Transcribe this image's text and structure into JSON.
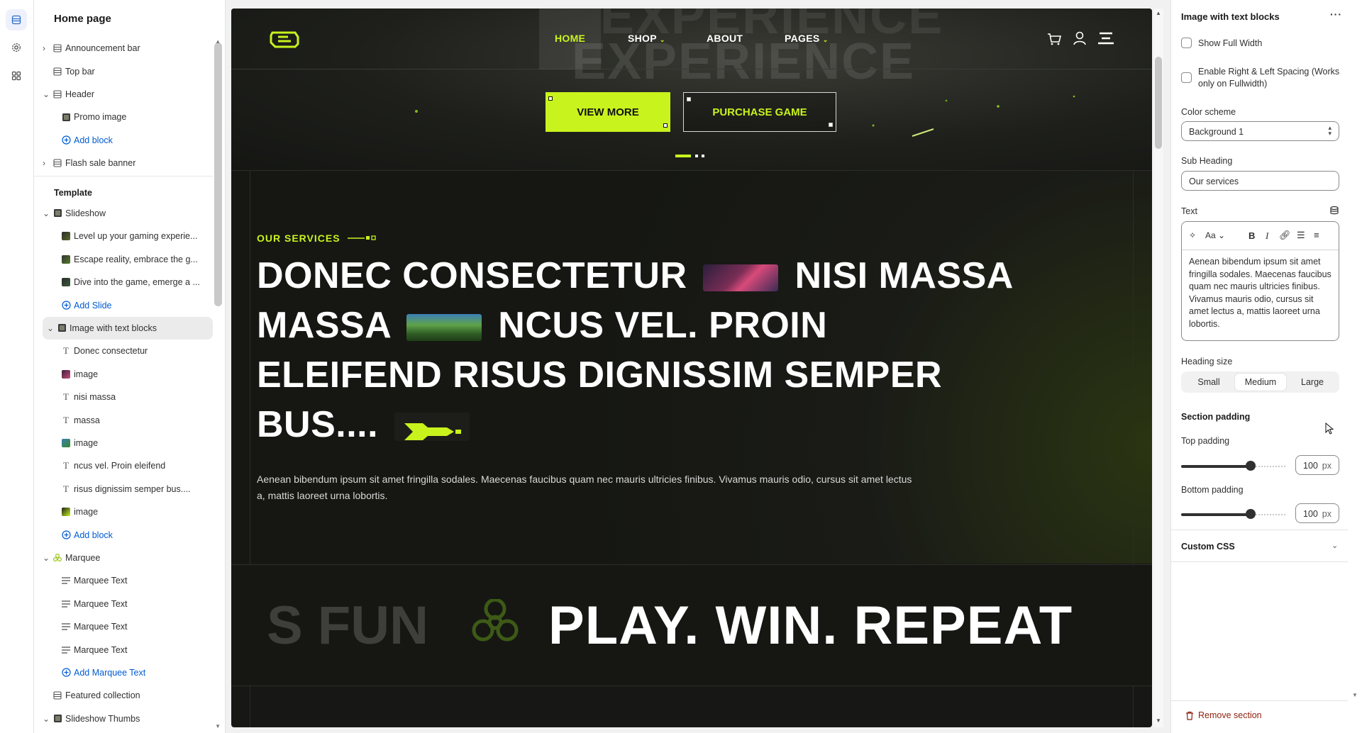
{
  "sidebar": {
    "title": "Home page",
    "items": [
      {
        "label": "Announcement bar",
        "icon": "section-icon",
        "chevron": "›"
      },
      {
        "label": "Top bar",
        "icon": "section-icon"
      },
      {
        "label": "Header",
        "icon": "section-icon",
        "chevron": "⌄"
      },
      {
        "label": "Promo image",
        "icon": "image-icon"
      },
      {
        "label": "Add block",
        "icon": "plus-circle-icon"
      },
      {
        "label": "Flash sale banner",
        "icon": "section-icon",
        "chevron": "›"
      },
      {
        "label": "Template"
      },
      {
        "label": "Slideshow",
        "icon": "image-icon",
        "chevron": "⌄"
      },
      {
        "label": "Level up your gaming experie...",
        "icon": "image-icon"
      },
      {
        "label": "Escape reality, embrace the g...",
        "icon": "image-icon"
      },
      {
        "label": "Dive into the game, emerge a ...",
        "icon": "image-icon"
      },
      {
        "label": "Add Slide",
        "icon": "plus-circle-icon"
      },
      {
        "label": "Image with text blocks",
        "icon": "image-icon",
        "chevron": "⌄"
      },
      {
        "label": "Donec consectetur",
        "icon": "text-icon"
      },
      {
        "label": "image",
        "icon": "image-icon"
      },
      {
        "label": "nisi massa",
        "icon": "text-icon"
      },
      {
        "label": "massa",
        "icon": "text-icon"
      },
      {
        "label": "image",
        "icon": "image-icon"
      },
      {
        "label": "ncus vel. Proin eleifend",
        "icon": "text-icon"
      },
      {
        "label": "risus dignissim semper bus....",
        "icon": "text-icon"
      },
      {
        "label": "image",
        "icon": "image-icon"
      },
      {
        "label": "Add block",
        "icon": "plus-circle-icon"
      },
      {
        "label": "Marquee",
        "icon": "biohazard-icon",
        "chevron": "⌄"
      },
      {
        "label": "Marquee Text",
        "icon": "lines-icon"
      },
      {
        "label": "Marquee Text",
        "icon": "lines-icon"
      },
      {
        "label": "Marquee Text",
        "icon": "lines-icon"
      },
      {
        "label": "Marquee Text",
        "icon": "lines-icon"
      },
      {
        "label": "Add Marquee Text",
        "icon": "plus-circle-icon"
      },
      {
        "label": "Featured collection",
        "icon": "section-icon"
      },
      {
        "label": "Slideshow Thumbs",
        "icon": "image-icon",
        "chevron": "⌄"
      }
    ]
  },
  "preview": {
    "nav": {
      "home": "HOME",
      "shop": "SHOP",
      "about": "ABOUT",
      "pages": "PAGES"
    },
    "hero_bg_text": "EXPERIENCE",
    "view_more": "VIEW MORE",
    "purchase": "PURCHASE GAME",
    "sub_heading": "OUR SERVICES",
    "heading": {
      "l1a": "DONEC CONSECTETUR",
      "l1b": "NISI MASSA",
      "l2a": "MASSA",
      "l2b": "NCUS VEL. PROIN",
      "l3": "ELEIFEND RISUS DIGNISSIM SEMPER",
      "l4": "BUS...."
    },
    "paragraph": "Aenean bibendum ipsum sit amet fringilla sodales. Maecenas faucibus quam nec mauris ultricies finibus. Vivamus mauris odio, cursus sit amet lectus a, mattis laoreet urna lobortis.",
    "marquee_faded": "S FUN",
    "marquee_main": "PLAY. WIN. REPEAT",
    "accent": "#c8f31d"
  },
  "panel": {
    "title": "Image with text blocks",
    "show_full_width": "Show Full Width",
    "enable_spacing": "Enable Right & Left Spacing (Works only on Fullwidth)",
    "color_scheme_label": "Color scheme",
    "color_scheme_value": "Background 1",
    "sub_heading_label": "Sub Heading",
    "sub_heading_value": "Our services",
    "text_label": "Text",
    "text_value": "Aenean bibendum ipsum sit amet fringilla sodales. Maecenas faucibus quam nec mauris ultricies finibus. Vivamus mauris odio, cursus sit amet lectus a, mattis laoreet urna lobortis.",
    "heading_size_label": "Heading size",
    "sizes": [
      "Small",
      "Medium",
      "Large"
    ],
    "section_padding": "Section padding",
    "top_padding_label": "Top padding",
    "top_padding_value": "100",
    "bottom_padding_label": "Bottom padding",
    "bottom_padding_value": "100",
    "unit": "px",
    "custom_css": "Custom CSS",
    "remove_section": "Remove section"
  }
}
